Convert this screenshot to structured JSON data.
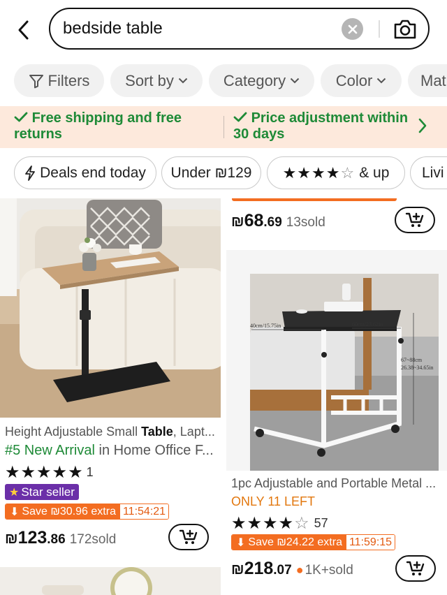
{
  "search": {
    "query": "bedside table"
  },
  "filters": [
    {
      "label": "Filters",
      "icon": "funnel-icon"
    },
    {
      "label": "Sort by"
    },
    {
      "label": "Category"
    },
    {
      "label": "Color"
    },
    {
      "label": "Mat"
    }
  ],
  "promo": {
    "left": "Free shipping and free returns",
    "right": "Price adjustment within 30 days"
  },
  "quick_filters": [
    {
      "label": "Deals end today",
      "icon": "lightning-icon"
    },
    {
      "label": "Under ₪129"
    },
    {
      "label": "& up",
      "stars": 4
    },
    {
      "label": "Livi"
    }
  ],
  "products": [
    {
      "title_pre": "Height Adjustable Small ",
      "title_bold": "Table",
      "title_post": ", Lapt...",
      "rank_hl": "#5 New Arrival",
      "rank_rest": " in Home Office F...",
      "rating": 5,
      "review_count": "1",
      "badge": "Star seller",
      "save": "Save ₪30.96 extra",
      "timer": "11:54:21",
      "currency": "₪",
      "price_int": "123",
      "price_dec": ".86",
      "sold": "172sold"
    },
    {
      "currency": "₪",
      "price_int": "68",
      "price_dec": ".69",
      "sold": "13sold"
    },
    {
      "title": "1pc Adjustable and Portable Metal ...",
      "stock": "ONLY 11 LEFT",
      "rating": 4.5,
      "review_count": "57",
      "save": "Save ₪24.22 extra",
      "timer": "11:59:15",
      "currency": "₪",
      "price_int": "218",
      "price_dec": ".07",
      "sold": "1K+sold",
      "image_labels": [
        "40cm/15.75in",
        "60cm/23.62in",
        "67~88cm",
        "26.38~34.65in"
      ]
    }
  ],
  "colors": {
    "accent_green": "#1e8a37",
    "save_orange": "#f36d21",
    "stock_orange": "#e2770e",
    "promo_bg": "#fde9dc",
    "star_seller_purple": "#6b2fa8"
  }
}
